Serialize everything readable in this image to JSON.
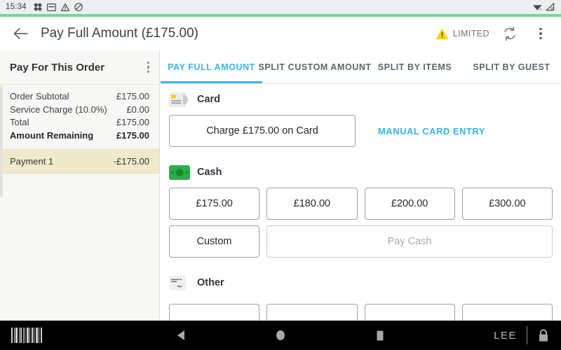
{
  "status_bar": {
    "time": "15:34",
    "left_icons": [
      "apps-grid-icon",
      "card-reader-icon",
      "warning-triangle-icon",
      "do-not-disturb-icon"
    ],
    "right_icons": [
      "wifi-signal-icon",
      "cellular-signal-icon"
    ]
  },
  "accent_bar_color": "#68dc93",
  "app_bar": {
    "back_icon": "arrow-back-icon",
    "title": "Pay Full Amount (£175.00)",
    "status_badge": {
      "icon": "warning-triangle-icon",
      "label": "LIMITED",
      "color": "#f5d600"
    },
    "sync_icon": "sync-refresh-icon",
    "overflow_icon": "more-vertical-icon"
  },
  "sidebar": {
    "title": "Pay For This Order",
    "overflow_icon": "more-vertical-icon",
    "totals": [
      {
        "label": "Order Subtotal",
        "value": "£175.00",
        "bold": false
      },
      {
        "label": "Service Charge (10.0%)",
        "value": "£0.00",
        "bold": false
      },
      {
        "label": "Total",
        "value": "£175.00",
        "bold": false
      },
      {
        "label": "Amount Remaining",
        "value": "£175.00",
        "bold": true
      }
    ],
    "payments": [
      {
        "label": "Payment 1",
        "value": "-£175.00",
        "highlight_color": "#efeac9"
      }
    ]
  },
  "tabs": {
    "active_color": "#39b5e8",
    "items": [
      {
        "label": "PAY FULL AMOUNT",
        "active": true
      },
      {
        "label": "SPLIT CUSTOM AMOUNT",
        "active": false
      },
      {
        "label": "SPLIT BY ITEMS",
        "active": false
      },
      {
        "label": "SPLIT BY GUEST",
        "active": false
      }
    ]
  },
  "payment_sections": {
    "card": {
      "icon": "credit-card-icon",
      "label": "Card",
      "charge_button": "Charge £175.00 on Card",
      "manual_link": "MANUAL CARD ENTRY",
      "link_color": "#36b3e8"
    },
    "cash": {
      "icon": "cash-banknote-icon",
      "label": "Cash",
      "icon_color": "#2bb14b",
      "quick_amounts": [
        "£175.00",
        "£180.00",
        "£200.00",
        "£300.00"
      ],
      "custom_button": "Custom",
      "pay_button": "Pay Cash"
    },
    "other": {
      "icon": "cheque-icon",
      "label": "Other"
    }
  },
  "nav_bar": {
    "barcode_icon": "barcode-scanner-icon",
    "back_icon": "nav-back-triangle-icon",
    "home_icon": "nav-home-circle-icon",
    "recents_icon": "nav-recents-square-icon",
    "user": "LEE",
    "lock_icon": "lock-icon"
  }
}
